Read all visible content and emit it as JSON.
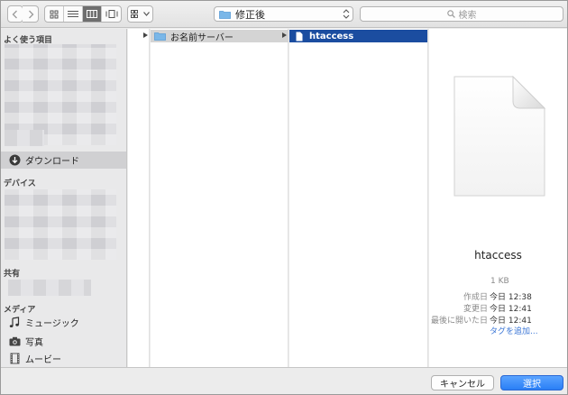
{
  "toolbar": {
    "back_icon": "chevron-left-icon",
    "forward_icon": "chevron-right-icon",
    "view_modes": [
      "icon-view",
      "list-view",
      "column-view",
      "cover-flow-view"
    ],
    "active_view": "column-view",
    "arrange_icon": "grid-arrange-icon",
    "location": "修正後",
    "search_placeholder": "検索"
  },
  "sidebar": {
    "favorites_header": "よく使う項目",
    "downloads_label": "ダウンロード",
    "devices_header": "デバイス",
    "shared_header": "共有",
    "media_header": "メディア",
    "media_items": [
      "ミュージック",
      "写真",
      "ムービー"
    ]
  },
  "browser": {
    "column1_folder": "お名前サーバー",
    "column2_file": "htaccess"
  },
  "preview": {
    "name": "htaccess",
    "size": "1 KB",
    "created_label": "作成日",
    "created_value": "今日 12:38",
    "modified_label": "変更日",
    "modified_value": "今日 12:41",
    "opened_label": "最後に開いた日",
    "opened_value": "今日 12:41",
    "add_tags": "タグを追加..."
  },
  "buttons": {
    "cancel": "キャンセル",
    "select": "選択"
  },
  "colors": {
    "selection_blue": "#1b4da0",
    "primary_button": "#2a7ff6",
    "folder_blue": "#7ab7e8"
  }
}
